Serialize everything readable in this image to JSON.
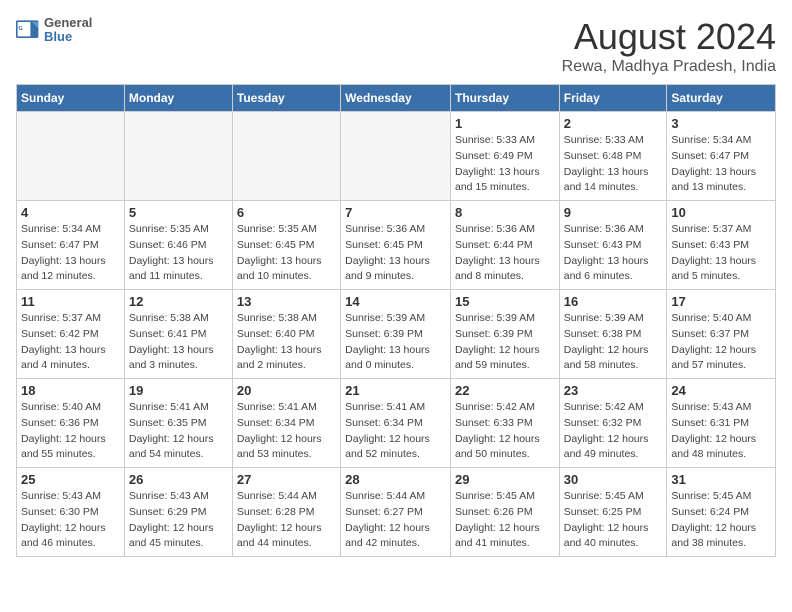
{
  "logo": {
    "text_general": "General",
    "text_blue": "Blue"
  },
  "title": "August 2024",
  "subtitle": "Rewa, Madhya Pradesh, India",
  "days_of_week": [
    "Sunday",
    "Monday",
    "Tuesday",
    "Wednesday",
    "Thursday",
    "Friday",
    "Saturday"
  ],
  "weeks": [
    [
      {
        "day": "",
        "info": ""
      },
      {
        "day": "",
        "info": ""
      },
      {
        "day": "",
        "info": ""
      },
      {
        "day": "",
        "info": ""
      },
      {
        "day": "1",
        "info": "Sunrise: 5:33 AM\nSunset: 6:49 PM\nDaylight: 13 hours\nand 15 minutes."
      },
      {
        "day": "2",
        "info": "Sunrise: 5:33 AM\nSunset: 6:48 PM\nDaylight: 13 hours\nand 14 minutes."
      },
      {
        "day": "3",
        "info": "Sunrise: 5:34 AM\nSunset: 6:47 PM\nDaylight: 13 hours\nand 13 minutes."
      }
    ],
    [
      {
        "day": "4",
        "info": "Sunrise: 5:34 AM\nSunset: 6:47 PM\nDaylight: 13 hours\nand 12 minutes."
      },
      {
        "day": "5",
        "info": "Sunrise: 5:35 AM\nSunset: 6:46 PM\nDaylight: 13 hours\nand 11 minutes."
      },
      {
        "day": "6",
        "info": "Sunrise: 5:35 AM\nSunset: 6:45 PM\nDaylight: 13 hours\nand 10 minutes."
      },
      {
        "day": "7",
        "info": "Sunrise: 5:36 AM\nSunset: 6:45 PM\nDaylight: 13 hours\nand 9 minutes."
      },
      {
        "day": "8",
        "info": "Sunrise: 5:36 AM\nSunset: 6:44 PM\nDaylight: 13 hours\nand 8 minutes."
      },
      {
        "day": "9",
        "info": "Sunrise: 5:36 AM\nSunset: 6:43 PM\nDaylight: 13 hours\nand 6 minutes."
      },
      {
        "day": "10",
        "info": "Sunrise: 5:37 AM\nSunset: 6:43 PM\nDaylight: 13 hours\nand 5 minutes."
      }
    ],
    [
      {
        "day": "11",
        "info": "Sunrise: 5:37 AM\nSunset: 6:42 PM\nDaylight: 13 hours\nand 4 minutes."
      },
      {
        "day": "12",
        "info": "Sunrise: 5:38 AM\nSunset: 6:41 PM\nDaylight: 13 hours\nand 3 minutes."
      },
      {
        "day": "13",
        "info": "Sunrise: 5:38 AM\nSunset: 6:40 PM\nDaylight: 13 hours\nand 2 minutes."
      },
      {
        "day": "14",
        "info": "Sunrise: 5:39 AM\nSunset: 6:39 PM\nDaylight: 13 hours\nand 0 minutes."
      },
      {
        "day": "15",
        "info": "Sunrise: 5:39 AM\nSunset: 6:39 PM\nDaylight: 12 hours\nand 59 minutes."
      },
      {
        "day": "16",
        "info": "Sunrise: 5:39 AM\nSunset: 6:38 PM\nDaylight: 12 hours\nand 58 minutes."
      },
      {
        "day": "17",
        "info": "Sunrise: 5:40 AM\nSunset: 6:37 PM\nDaylight: 12 hours\nand 57 minutes."
      }
    ],
    [
      {
        "day": "18",
        "info": "Sunrise: 5:40 AM\nSunset: 6:36 PM\nDaylight: 12 hours\nand 55 minutes."
      },
      {
        "day": "19",
        "info": "Sunrise: 5:41 AM\nSunset: 6:35 PM\nDaylight: 12 hours\nand 54 minutes."
      },
      {
        "day": "20",
        "info": "Sunrise: 5:41 AM\nSunset: 6:34 PM\nDaylight: 12 hours\nand 53 minutes."
      },
      {
        "day": "21",
        "info": "Sunrise: 5:41 AM\nSunset: 6:34 PM\nDaylight: 12 hours\nand 52 minutes."
      },
      {
        "day": "22",
        "info": "Sunrise: 5:42 AM\nSunset: 6:33 PM\nDaylight: 12 hours\nand 50 minutes."
      },
      {
        "day": "23",
        "info": "Sunrise: 5:42 AM\nSunset: 6:32 PM\nDaylight: 12 hours\nand 49 minutes."
      },
      {
        "day": "24",
        "info": "Sunrise: 5:43 AM\nSunset: 6:31 PM\nDaylight: 12 hours\nand 48 minutes."
      }
    ],
    [
      {
        "day": "25",
        "info": "Sunrise: 5:43 AM\nSunset: 6:30 PM\nDaylight: 12 hours\nand 46 minutes."
      },
      {
        "day": "26",
        "info": "Sunrise: 5:43 AM\nSunset: 6:29 PM\nDaylight: 12 hours\nand 45 minutes."
      },
      {
        "day": "27",
        "info": "Sunrise: 5:44 AM\nSunset: 6:28 PM\nDaylight: 12 hours\nand 44 minutes."
      },
      {
        "day": "28",
        "info": "Sunrise: 5:44 AM\nSunset: 6:27 PM\nDaylight: 12 hours\nand 42 minutes."
      },
      {
        "day": "29",
        "info": "Sunrise: 5:45 AM\nSunset: 6:26 PM\nDaylight: 12 hours\nand 41 minutes."
      },
      {
        "day": "30",
        "info": "Sunrise: 5:45 AM\nSunset: 6:25 PM\nDaylight: 12 hours\nand 40 minutes."
      },
      {
        "day": "31",
        "info": "Sunrise: 5:45 AM\nSunset: 6:24 PM\nDaylight: 12 hours\nand 38 minutes."
      }
    ]
  ]
}
